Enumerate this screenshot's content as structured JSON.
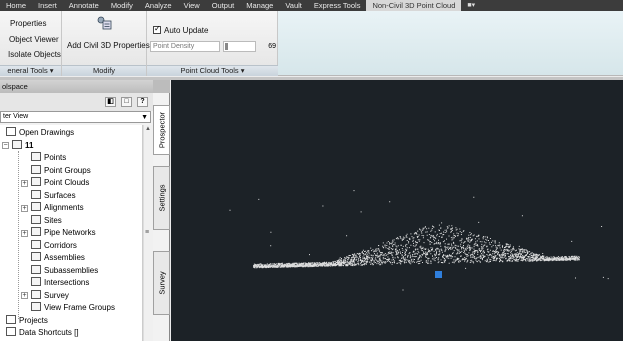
{
  "menubar": {
    "tabs": [
      "Home",
      "Insert",
      "Annotate",
      "Modify",
      "Analyze",
      "View",
      "Output",
      "Manage",
      "Vault",
      "Express Tools",
      "Non-Civil 3D Point Cloud"
    ],
    "active_tab": "Non-Civil 3D Point Cloud"
  },
  "ribbon": {
    "general_tools": {
      "title": "eneral Tools",
      "properties": "Properties",
      "object_viewer": "Object Viewer",
      "isolate_objects": "Isolate Objects"
    },
    "modify": {
      "title": "Modify",
      "add_properties": "Add Civil 3D Properties"
    },
    "point_cloud_tools": {
      "title": "Point Cloud Tools",
      "auto_update_label": "Auto Update",
      "auto_update_checked": true,
      "point_density_label": "Point Density",
      "point_density_value": "69"
    }
  },
  "toolspace": {
    "title": "olspace",
    "view_select": "ter View",
    "tree": [
      {
        "label": "Open Drawings",
        "level": 0,
        "expander": ""
      },
      {
        "label": "11",
        "level": 1,
        "expander": "−"
      },
      {
        "label": "Points",
        "level": 2,
        "expander": ""
      },
      {
        "label": "Point Groups",
        "level": 2,
        "expander": ""
      },
      {
        "label": "Point Clouds",
        "level": 2,
        "expander": "+"
      },
      {
        "label": "Surfaces",
        "level": 2,
        "expander": ""
      },
      {
        "label": "Alignments",
        "level": 2,
        "expander": "+"
      },
      {
        "label": "Sites",
        "level": 2,
        "expander": ""
      },
      {
        "label": "Pipe Networks",
        "level": 2,
        "expander": "+"
      },
      {
        "label": "Corridors",
        "level": 2,
        "expander": ""
      },
      {
        "label": "Assemblies",
        "level": 2,
        "expander": ""
      },
      {
        "label": "Subassemblies",
        "level": 2,
        "expander": ""
      },
      {
        "label": "Intersections",
        "level": 2,
        "expander": ""
      },
      {
        "label": "Survey",
        "level": 2,
        "expander": "+"
      },
      {
        "label": "View Frame Groups",
        "level": 2,
        "expander": ""
      },
      {
        "label": "Projects",
        "level": 0,
        "expander": ""
      },
      {
        "label": "Data Shortcuts []",
        "level": 0,
        "expander": ""
      }
    ],
    "tabs": [
      "Prospector",
      "Settings",
      "Survey"
    ],
    "active_tab": "Prospector"
  },
  "viewport": {
    "background": "#1c2227",
    "point_color": "#ffffff",
    "marker_color": "#2f7fdc"
  }
}
